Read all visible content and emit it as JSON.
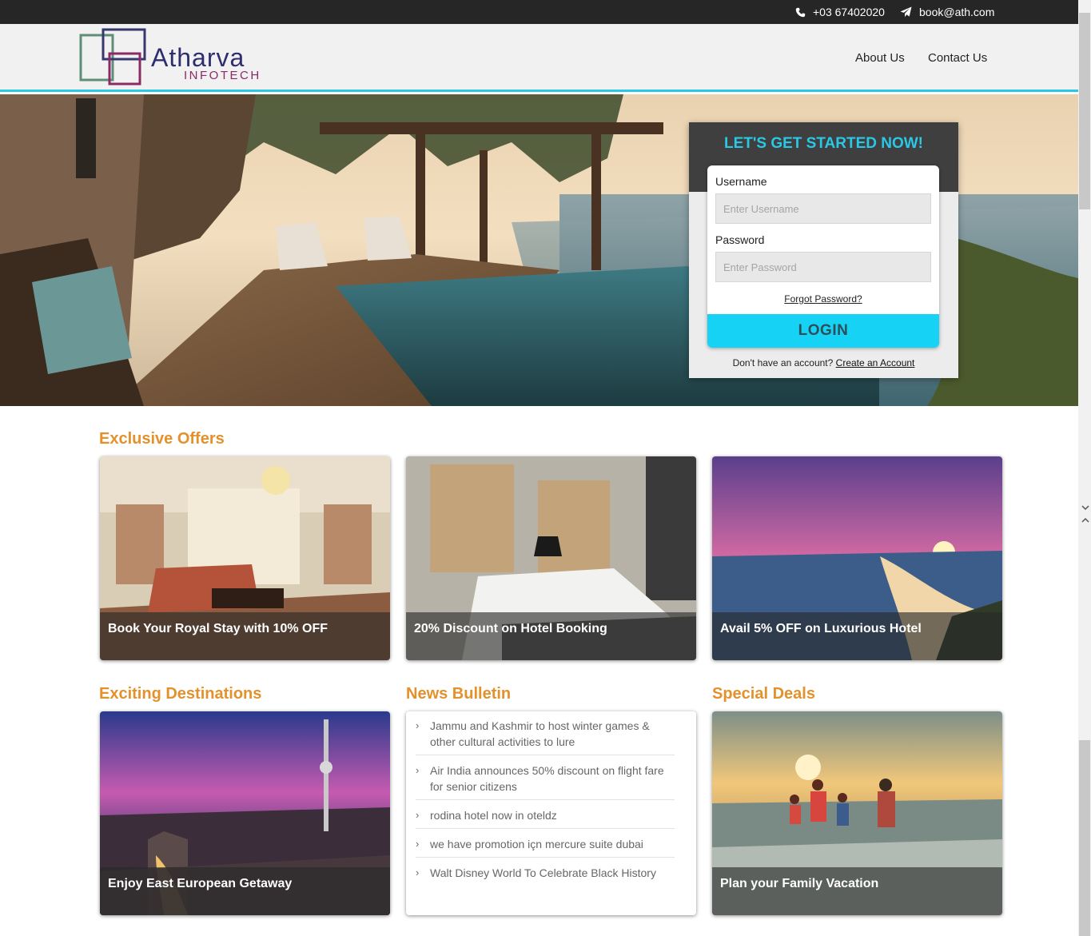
{
  "topbar": {
    "phone": "+03 67402020",
    "email": "book@ath.com"
  },
  "header": {
    "logo_word": "Atharva",
    "logo_sub": "INFOTECH",
    "nav": [
      "About Us",
      "Contact Us"
    ]
  },
  "login": {
    "title": "LET'S GET STARTED NOW!",
    "username_label": "Username",
    "username_placeholder": "Enter Username",
    "password_label": "Password",
    "password_placeholder": "Enter Password",
    "forgot": "Forgot Password?",
    "button": "LOGIN",
    "signup_prompt": "Don't have an account?",
    "signup_link": "Create an Account"
  },
  "sections": {
    "offers_title": "Exclusive Offers",
    "destinations_title": "Exciting Destinations",
    "news_title": "News Bulletin",
    "deals_title": "Special Deals"
  },
  "offers": [
    {
      "caption": "Book Your Royal Stay with 10% OFF"
    },
    {
      "caption": "20% Discount on Hotel Booking"
    },
    {
      "caption": "Avail 5% OFF on Luxurious Hotel"
    }
  ],
  "destination": {
    "caption": "Enjoy East European Getaway"
  },
  "deal": {
    "caption": "Plan your Family Vacation"
  },
  "news": [
    "Jammu and Kashmir to host winter games & other cultural activities to lure",
    "Air India announces 50% discount on flight fare for senior citizens",
    "rodina hotel now in oteldz",
    "we have promotion içn mercure suite dubai",
    "Walt Disney World To Celebrate Black History"
  ],
  "colors": {
    "accent": "#2bc8e6",
    "login_button": "#16d3f5",
    "section_title": "#e4912b",
    "topbar": "#262626"
  },
  "icons": {
    "phone": "phone-icon",
    "email": "paper-plane-icon",
    "news_bullet": "chevron-right-icon"
  }
}
